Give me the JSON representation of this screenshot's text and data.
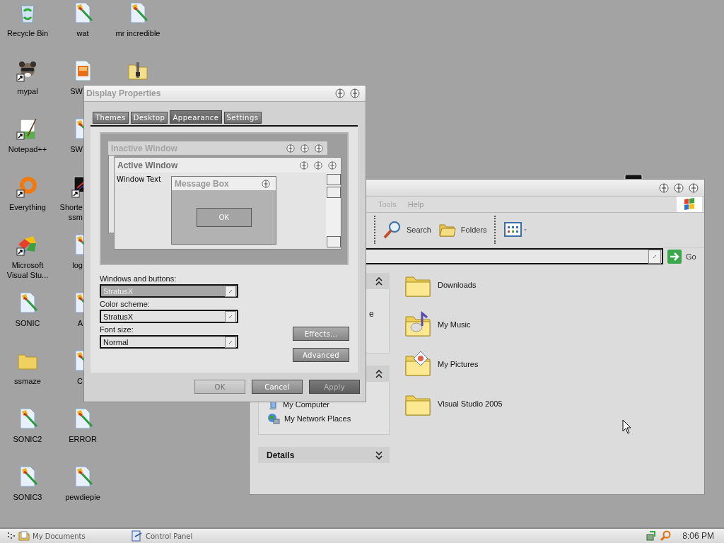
{
  "desktop_icons": [
    {
      "label": "Recycle Bin",
      "kind": "recycle",
      "shortcut": false,
      "covered": false
    },
    {
      "label": "mypal",
      "kind": "animal",
      "shortcut": true,
      "covered": false
    },
    {
      "label": "Notepad++",
      "kind": "notepad",
      "shortcut": true,
      "covered": false
    },
    {
      "label": "Everything",
      "kind": "ring",
      "shortcut": true,
      "covered": false
    },
    {
      "label": "Microsoft Visual Stu...",
      "kind": "vs",
      "shortcut": true,
      "covered": false
    },
    {
      "label": "SONIC",
      "kind": "paint-doc",
      "shortcut": false,
      "covered": false
    },
    {
      "label": "ssmaze",
      "kind": "folder",
      "shortcut": false,
      "covered": false
    },
    {
      "label": "SONIC2",
      "kind": "paint-doc",
      "shortcut": false,
      "covered": false
    },
    {
      "label": "SONIC3",
      "kind": "paint-doc",
      "shortcut": false,
      "covered": false
    },
    {
      "label": "wat",
      "kind": "paint-doc",
      "shortcut": false,
      "covered": false
    },
    {
      "label": "SW",
      "kind": "image-doc",
      "shortcut": false,
      "covered": true
    },
    {
      "label": "SW",
      "kind": "paint-doc",
      "shortcut": false,
      "covered": true
    },
    {
      "label": "Shorte ssm",
      "kind": "terminal",
      "shortcut": true,
      "covered": true
    },
    {
      "label": "log",
      "kind": "paint-doc",
      "shortcut": false,
      "covered": true
    },
    {
      "label": "A",
      "kind": "paint-doc",
      "shortcut": false,
      "covered": true
    },
    {
      "label": "C",
      "kind": "paint-doc",
      "shortcut": false,
      "covered": true
    },
    {
      "label": "ERROR",
      "kind": "paint-doc",
      "shortcut": false,
      "covered": false
    },
    {
      "label": "pewdiepie",
      "kind": "paint-doc",
      "shortcut": false,
      "covered": false
    },
    {
      "label": "mr incredible",
      "kind": "paint-doc",
      "shortcut": false,
      "covered": false
    },
    {
      "kind": "zip",
      "shortcut": false
    }
  ],
  "explorer": {
    "menu": [
      "Tools",
      "Help"
    ],
    "toolbar": [
      {
        "label": "Search",
        "kind": "search"
      },
      {
        "label": "Folders",
        "kind": "folders"
      },
      {
        "kind": "views"
      }
    ],
    "go_button": "Go",
    "task_panels": [
      {
        "expanded": true,
        "items": [
          {
            "label": "e",
            "kind": "text"
          }
        ]
      },
      {
        "expanded": true,
        "items": [
          {
            "label": "My Computer",
            "kind": "computer"
          },
          {
            "label": "My Network Places",
            "kind": "network"
          }
        ]
      },
      {
        "title": "Details",
        "expanded": false
      }
    ],
    "folders": [
      {
        "label": "Downloads",
        "kind": "plain"
      },
      {
        "label": "My Music",
        "kind": "music"
      },
      {
        "label": "My Pictures",
        "kind": "pictures"
      },
      {
        "label": "Visual Studio 2005",
        "kind": "plain"
      }
    ]
  },
  "display_properties": {
    "title": "Display Properties",
    "tabs": [
      {
        "label": "Themes",
        "selected": false
      },
      {
        "label": "Desktop",
        "selected": false
      },
      {
        "label": "Appearance",
        "selected": true
      },
      {
        "label": "Settings",
        "selected": false
      }
    ],
    "preview": {
      "inactive_title": "Inactive Window",
      "active_title": "Active Window",
      "window_text": "Window Text",
      "message_title": "Message Box",
      "message_button": "OK"
    },
    "fields": [
      {
        "label": "Windows and buttons:",
        "value": "StratusX",
        "disabled": true
      },
      {
        "label": "Color scheme:",
        "value": "StratusX",
        "disabled": false
      },
      {
        "label": "Font size:",
        "value": "Normal",
        "disabled": false
      }
    ],
    "side_buttons": [
      "Effects...",
      "Advanced"
    ],
    "buttons": [
      {
        "label": "OK",
        "default": true,
        "disabled": false
      },
      {
        "label": "Cancel",
        "default": false,
        "disabled": false
      },
      {
        "label": "Apply",
        "default": false,
        "disabled": true
      }
    ]
  },
  "taskbar": {
    "tasks": [
      {
        "label": "My Documents",
        "kind": "folder"
      },
      {
        "label": "Control Panel",
        "kind": "control"
      }
    ],
    "clock": "8:06 PM"
  }
}
